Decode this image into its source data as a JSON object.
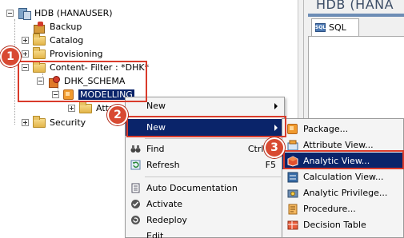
{
  "tree": {
    "root_label": "HDB (HANAUSER)",
    "items": [
      {
        "label": "Backup"
      },
      {
        "label": "Catalog"
      },
      {
        "label": "Provisioning"
      },
      {
        "label": "Content- Filter : *DHK*"
      },
      {
        "label": "DHK_SCHEMA"
      },
      {
        "label": "MODELLING"
      },
      {
        "label": "Attr"
      },
      {
        "label": "Security"
      }
    ]
  },
  "right_pane": {
    "title": "HDB (HANA",
    "tab_label": "SQL"
  },
  "context_menu": {
    "items": [
      {
        "label": "New"
      },
      {
        "label": "New"
      },
      {
        "label": "Find",
        "shortcut": "Ctrl+F"
      },
      {
        "label": "Refresh",
        "shortcut": "F5"
      },
      {
        "label": "Auto Documentation"
      },
      {
        "label": "Activate"
      },
      {
        "label": "Redeploy"
      },
      {
        "label": "Edit"
      }
    ]
  },
  "submenu": {
    "items": [
      {
        "label": "Package..."
      },
      {
        "label": "Attribute View..."
      },
      {
        "label": "Analytic View..."
      },
      {
        "label": "Calculation View..."
      },
      {
        "label": "Analytic Privilege..."
      },
      {
        "label": "Procedure..."
      },
      {
        "label": "Decision Table"
      }
    ]
  },
  "badges": {
    "one": "1",
    "two": "2",
    "three": "3"
  },
  "colors": {
    "highlight": "#0a246a",
    "annotation_red": "#d93b2b",
    "badge_red": "#d84a32"
  }
}
